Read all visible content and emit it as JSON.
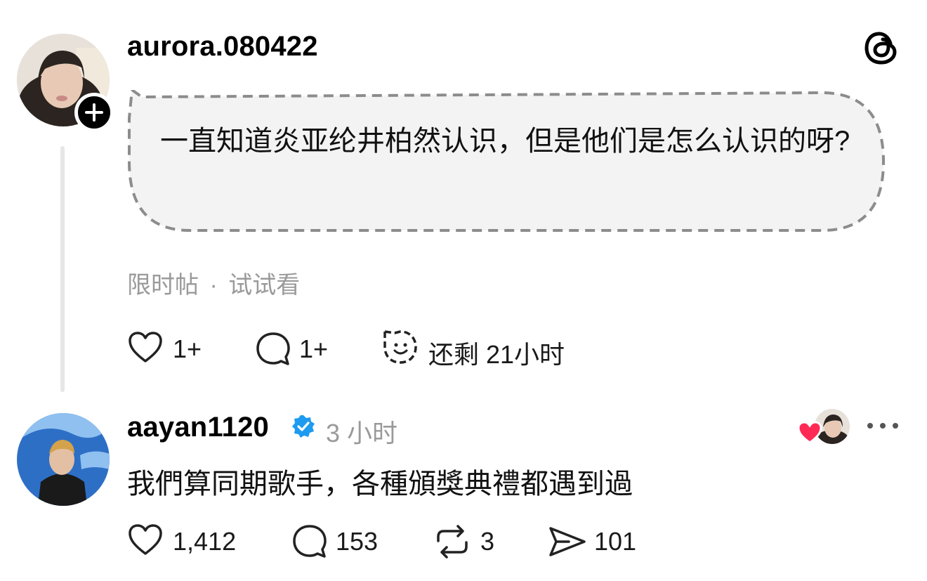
{
  "post": {
    "username": "aurora.080422",
    "message": "一直知道炎亚纶井柏然认识，但是他们是怎么认识的呀?",
    "meta_type": "限时帖",
    "meta_separator": "·",
    "meta_try": "试试看",
    "like_count": "1+",
    "reply_count": "1+",
    "time_left": "还剩 21小时"
  },
  "reply": {
    "username": "aayan1120",
    "time": "3 小时",
    "text": "我們算同期歌手，各種頒獎典禮都遇到過",
    "like_count": "1,412",
    "reply_count": "153",
    "repost_count": "3",
    "share_count": "101"
  },
  "colors": {
    "verified": "#1d9bf0",
    "heart": "#ff2a55",
    "bubble_bg": "#f3f3f3",
    "bubble_border": "#8c8c8c",
    "muted_text": "#9a9a9a"
  },
  "icons": [
    "threads-logo-icon",
    "follow-plus-icon",
    "heart-icon",
    "reply-icon",
    "smiley-timer-icon",
    "verified-badge-icon",
    "repost-icon",
    "share-icon",
    "more-icon",
    "liked-by-author-icon"
  ]
}
